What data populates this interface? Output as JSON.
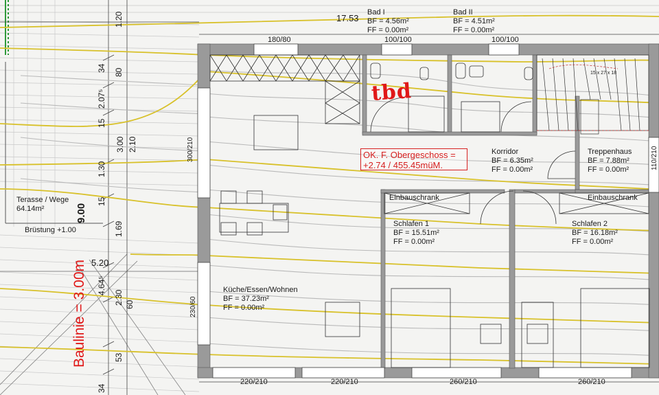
{
  "colors": {
    "wall": "#9a9a9a",
    "contour_yellow": "#d8c12a",
    "contour_gray": "#b8b8b8",
    "annotation_red": "#e01818",
    "green_edge": "#2f9a3a"
  },
  "rooms": {
    "bad1": {
      "name": "Bad I",
      "bf": "BF = 4.56m²",
      "ff": "FF = 0.00m²"
    },
    "bad2": {
      "name": "Bad II",
      "bf": "BF = 4.51m²",
      "ff": "FF = 0.00m²"
    },
    "korridor": {
      "name": "Korridor",
      "bf": "BF = 6.35m²",
      "ff": "FF = 0.00m²"
    },
    "treppenhaus": {
      "name": "Treppenhaus",
      "bf": "BF = 7.88m²",
      "ff": "FF = 0.00m²"
    },
    "schlafen1": {
      "name": "Schlafen 1",
      "bf": "BF = 15.51m²",
      "ff": "FF = 0.00m²"
    },
    "schlafen2": {
      "name": "Schlafen 2",
      "bf": "BF = 16.18m²",
      "ff": "FF = 0.00m²"
    },
    "kueche": {
      "name": "Küche/Essen/Wohnen",
      "bf": "BF = 37.23m²",
      "ff": "FF = 0.00m²"
    },
    "terasse": {
      "name": "Terasse / Wege",
      "area": "64.14m²"
    }
  },
  "labels": {
    "einbau1": "Einbauschrank",
    "einbau2": "Einbauschrank",
    "bruestung": "Brüstung +1.00",
    "stair": "15 x 27 x 18"
  },
  "annotations": {
    "note_line1": "OK. F. Obergeschoss =",
    "note_line2": "+2.74 / 455.45müM.",
    "tbd": "tbd",
    "baulinie": "Baulinie = 3.00m"
  },
  "dimensions": {
    "top_total": "17.53",
    "win_180_80": "180/80",
    "win_100_a": "100/100",
    "win_100_b": "100/100",
    "bottom_1": "220/210",
    "bottom_2": "220/210",
    "bottom_3": "260/210",
    "bottom_4": "260/210",
    "left_300_210": "300/210",
    "left_230_60": "230/60",
    "right_110": "110/210",
    "d_120": "1.20",
    "d_34_top": "34",
    "d_80": "80",
    "d_2075": "2.07⁵",
    "d_15a": "15",
    "d_300": "3.00",
    "d_210": "2.10",
    "d_130": "1.30",
    "d_15b": "15",
    "d_900": "9.00",
    "d_169": "1.69",
    "d_520": "5.20",
    "d_4645": "4.64⁵",
    "d_230": "2.30",
    "d_60": "60",
    "d_53": "53",
    "d_34_bottom": "34"
  }
}
